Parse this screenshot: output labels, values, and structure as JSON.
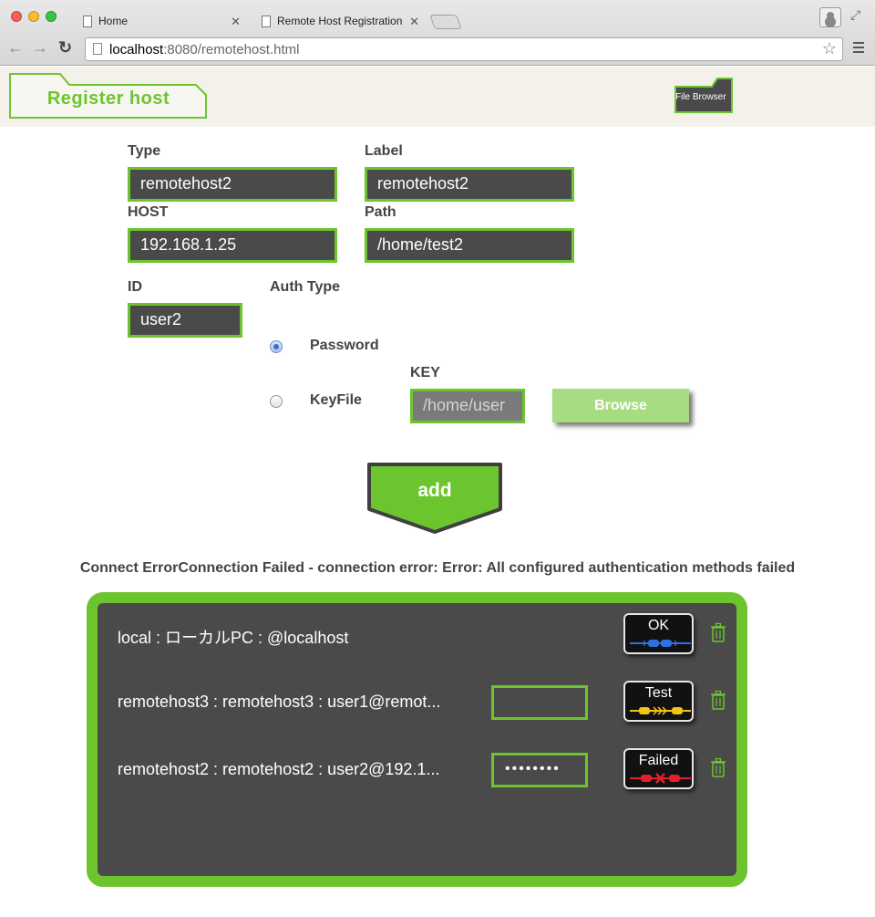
{
  "browser": {
    "tabs": [
      {
        "label": "Home"
      },
      {
        "label": "Remote Host Registration"
      }
    ],
    "url_host": "localhost",
    "url_rest": ":8080/remotehost.html"
  },
  "header": {
    "register_tab": "Register host",
    "file_browser_tab": "File Browser"
  },
  "form": {
    "type_label": "Type",
    "type_value": "remotehost2",
    "label_label": "Label",
    "label_value": "remotehost2",
    "host_label": "HOST",
    "host_value": "192.168.1.25",
    "path_label": "Path",
    "path_value": "/home/test2",
    "id_label": "ID",
    "id_value": "user2",
    "auth_type_label": "Auth Type",
    "auth_options": [
      {
        "label": "Password",
        "selected": true
      },
      {
        "label": "KeyFile",
        "selected": false
      }
    ],
    "key_label": "KEY",
    "key_placeholder": "/home/user",
    "browse_label": "Browse",
    "add_label": "add"
  },
  "error_message": "Connect ErrorConnection Failed - connection error: Error: All configured authentication methods failed",
  "hosts": [
    {
      "text": "local : ローカルPC : @localhost",
      "password": "",
      "status": "OK",
      "status_color": "#2f6fe0"
    },
    {
      "text": "remotehost3 : remotehost3 : user1@remot...",
      "password": "",
      "status": "Test",
      "status_color": "#f2c418"
    },
    {
      "text": "remotehost2 : remotehost2 : user2@192.1...",
      "password": "••••••••",
      "status": "Failed",
      "status_color": "#e0202a"
    }
  ],
  "colors": {
    "accent": "#6cc52e",
    "panel_bg": "#4a4a4a"
  }
}
